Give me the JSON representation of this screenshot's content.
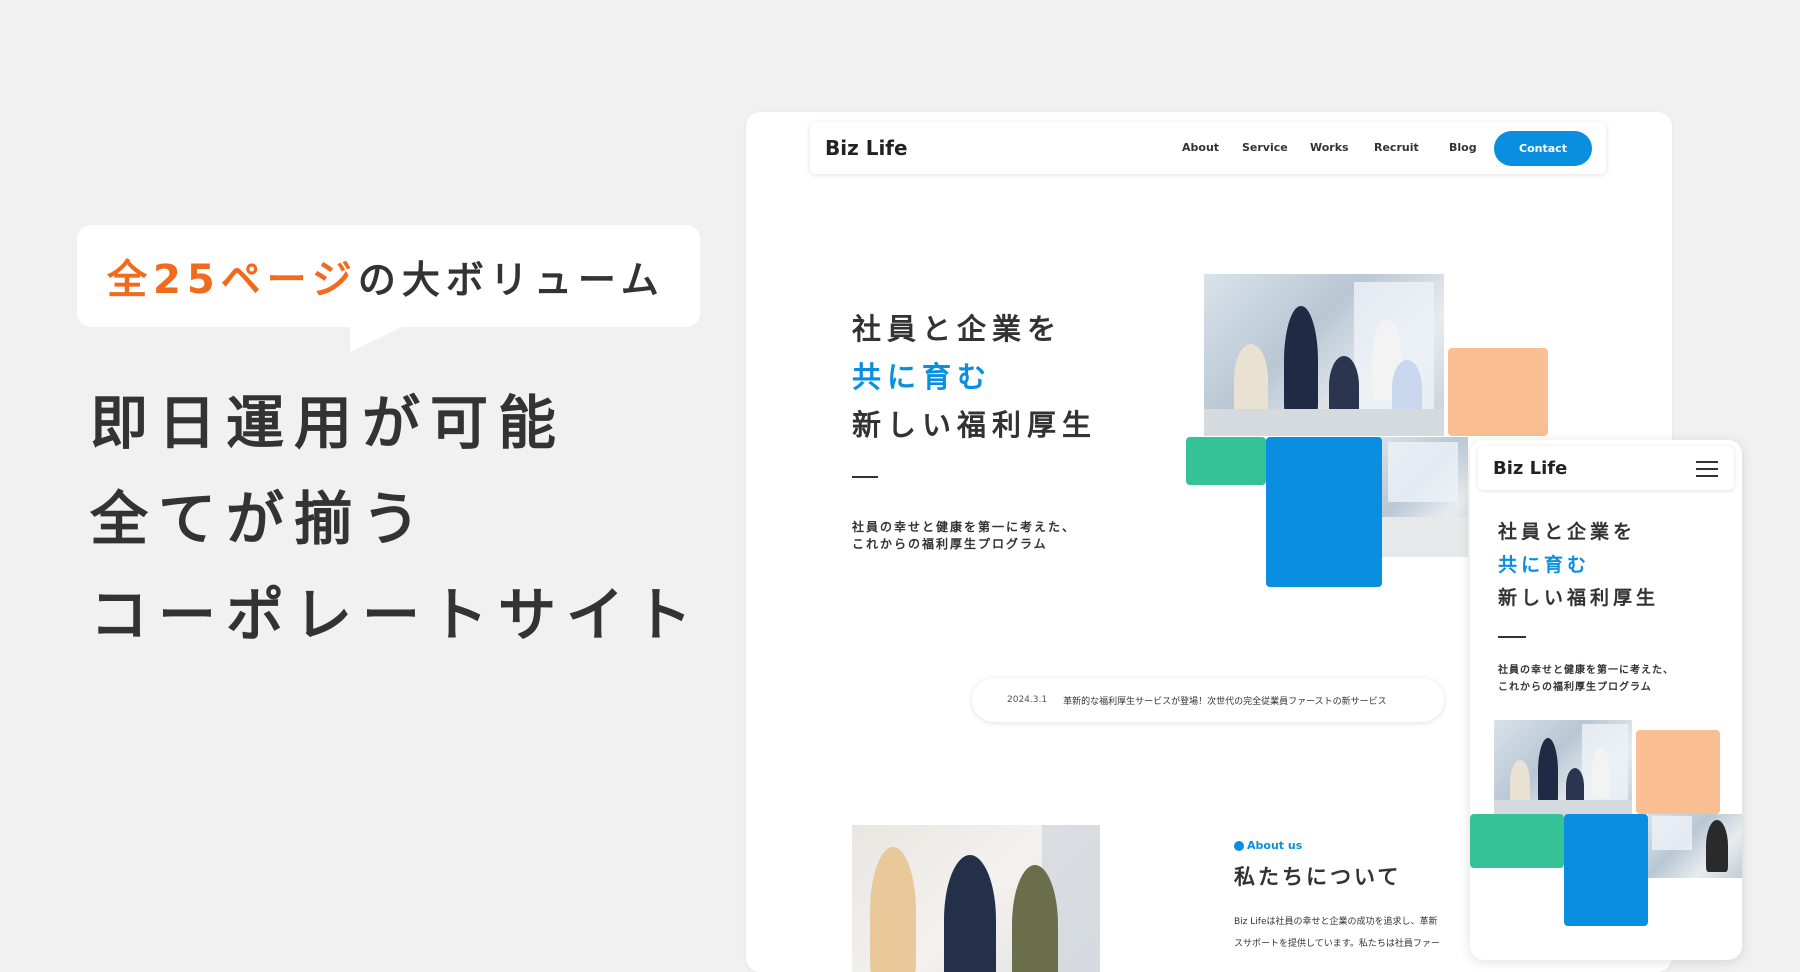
{
  "promo": {
    "badge_highlight": "全25ページ",
    "badge_rest": "の大ボリューム",
    "headline": [
      "即日運用が可能",
      "全てが揃う",
      "コーポレートサイト"
    ]
  },
  "desktop": {
    "logo": "Biz Life",
    "nav": [
      "About",
      "Service",
      "Works",
      "Recruit",
      "Blog"
    ],
    "contact": "Contact",
    "hero": {
      "line1": "社員と企業を",
      "line2": "共に育む",
      "line3": "新しい福利厚生",
      "sub1": "社員の幸せと健康を第一に考えた、",
      "sub2": "これからの福利厚生プログラム"
    },
    "news": {
      "date": "2024.3.1",
      "text": "革新的な福利厚生サービスが登場！次世代の完全従業員ファーストの新サービス"
    },
    "about": {
      "tag": "About us",
      "title": "私たちについて",
      "body1": "Biz Lifeは社員の幸せと企業の成功を追求し、革新",
      "body2": "スサポートを提供しています。私たちは社員ファー"
    }
  },
  "mobile": {
    "logo": "Biz Life",
    "hero": {
      "line1": "社員と企業を",
      "line2": "共に育む",
      "line3": "新しい福利厚生",
      "sub1": "社員の幸せと健康を第一に考えた、",
      "sub2": "これからの福利厚生プログラム"
    }
  },
  "colors": {
    "accent_orange": "#f26a1b",
    "brand_blue": "#0a8fe0",
    "block_green": "#35c296",
    "block_peach": "#f9bf93"
  },
  "icons": [
    "menu-icon"
  ]
}
